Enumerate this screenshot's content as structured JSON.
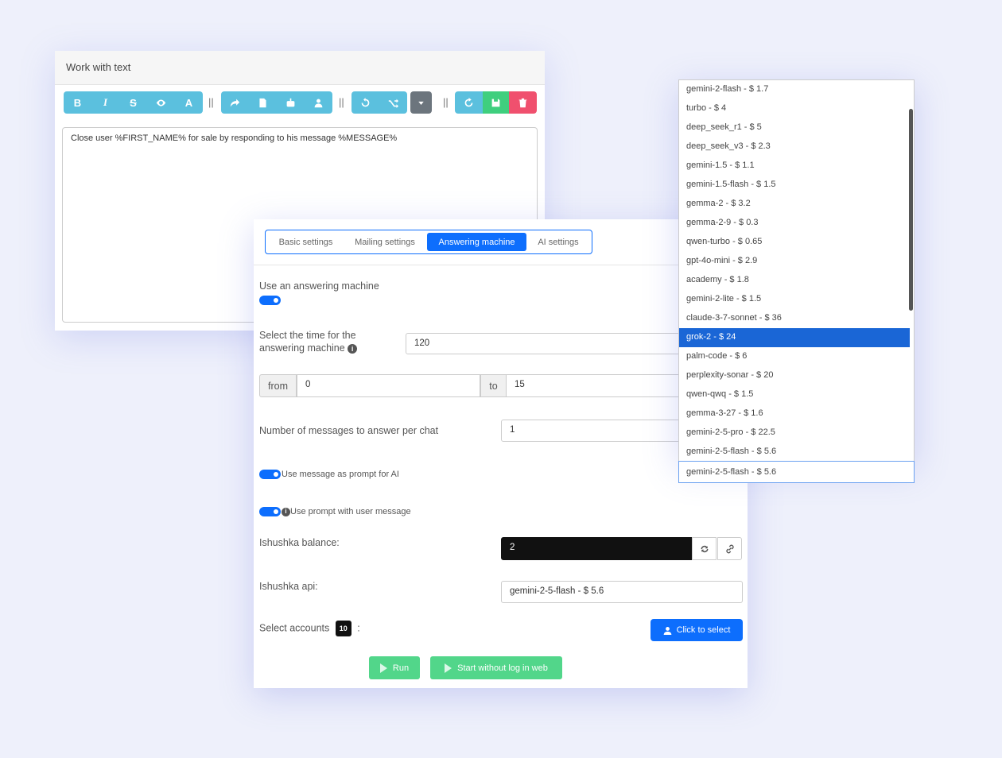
{
  "text_panel": {
    "title": "Work with text",
    "toolbar": {
      "bold": "B",
      "italic": "I",
      "strike": "S",
      "font": "A",
      "separator": "||"
    },
    "editor_text": "Close user %FIRST_NAME% for sale by responding to his message %MESSAGE%"
  },
  "tabs": [
    "Basic settings",
    "Mailing settings",
    "Answering machine",
    "AI settings"
  ],
  "form": {
    "use_answering_machine_label": "Use an answering machine",
    "use_answering_machine_on": true,
    "select_time_label": "Select the time for the answering machine",
    "time_value": "120",
    "from_label": "from",
    "from_value": "0",
    "to_label": "to",
    "to_value": "15",
    "messages_per_chat_label": "Number of messages to answer per chat",
    "messages_per_chat_value": "1",
    "use_message_as_prompt_label": "Use message as prompt for AI",
    "use_prompt_with_user_message_label": "Use prompt with user message",
    "balance_label": "Ishushka balance:",
    "balance_value": "2",
    "api_label": "Ishushka api:",
    "api_value": "gemini-2-5-flash - $ 5.6",
    "select_accounts_label": "Select accounts",
    "accounts_count": "10",
    "colon": ":",
    "click_to_select": "Click to select",
    "run": "Run",
    "start_without_log": "Start without log in web"
  },
  "dropdown": {
    "options": [
      "gemini-2-flash - $ 1.7",
      "turbo - $ 4",
      "deep_seek_r1 - $ 5",
      "deep_seek_v3 - $ 2.3",
      "gemini-1.5 - $ 1.1",
      "gemini-1.5-flash - $ 1.5",
      "gemma-2 - $ 3.2",
      "gemma-2-9 - $ 0.3",
      "qwen-turbo - $ 0.65",
      "gpt-4o-mini - $ 2.9",
      "academy - $ 1.8",
      "gemini-2-lite - $ 1.5",
      "claude-3-7-sonnet - $ 36",
      "grok-2 - $ 24",
      "palm-code - $ 6",
      "perplexity-sonar - $ 20",
      "qwen-qwq - $ 1.5",
      "gemma-3-27 - $ 1.6",
      "gemini-2-5-pro - $ 22.5",
      "gemini-2-5-flash - $ 5.6"
    ],
    "highlighted": "grok-2 - $ 24",
    "selected_value": "gemini-2-5-flash - $ 5.6"
  },
  "colors": {
    "primary": "#0d6efd",
    "info": "#5bc0de",
    "success": "#3fcf7e",
    "danger": "#f0506e",
    "secondary": "#6c757d"
  }
}
